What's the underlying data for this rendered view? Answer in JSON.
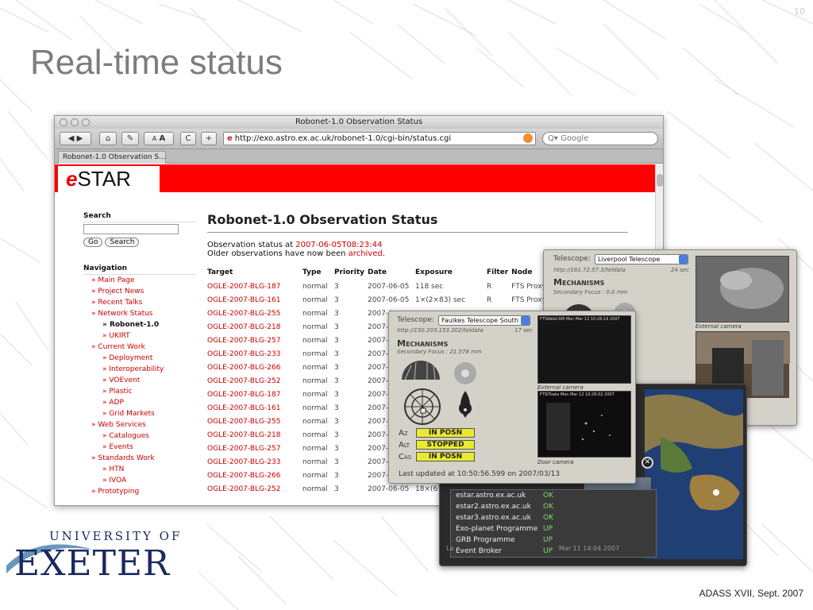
{
  "slide": {
    "number": "10",
    "title": "Real-time status",
    "footer": "ADASS XVII, Sept. 2007",
    "logo": {
      "line1": "UNIVERSITY OF",
      "line2": "EXETER"
    }
  },
  "browser": {
    "window_title": "Robonet-1.0 Observation Status",
    "url": "http://exo.astro.ex.ac.uk/robonet-1.0/cgi-bin/status.cgi",
    "search_placeholder": "Google",
    "tab_title": "Robonet-1.0 Observation S…",
    "toolbar": {
      "back": "◀",
      "forward": "▶",
      "home": "⌂",
      "edit": "✎",
      "text_small": "A",
      "text_large": "A",
      "reload": "C",
      "add": "+"
    }
  },
  "site": {
    "logo_e": "e",
    "logo_text": "STAR",
    "sidebar": {
      "search_heading": "Search",
      "go_label": "Go",
      "search_label": "Search",
      "nav_heading": "Navigation",
      "items": [
        {
          "label": "» Main Page",
          "level": 1
        },
        {
          "label": "» Project News",
          "level": 1
        },
        {
          "label": "» Recent Talks",
          "level": 1
        },
        {
          "label": "» Network Status",
          "level": 1
        },
        {
          "label": "» Robonet-1.0",
          "level": 2,
          "current": true
        },
        {
          "label": "» UKIRT",
          "level": 2
        },
        {
          "label": "» Current Work",
          "level": 1
        },
        {
          "label": "» Deployment",
          "level": 2
        },
        {
          "label": "» Interoperability",
          "level": 2
        },
        {
          "label": "» VOEvent",
          "level": 2
        },
        {
          "label": "» Plastic",
          "level": 2
        },
        {
          "label": "» ADP",
          "level": 2
        },
        {
          "label": "» Grid Markets",
          "level": 2
        },
        {
          "label": "» Web Services",
          "level": 1
        },
        {
          "label": "» Catalogues",
          "level": 2
        },
        {
          "label": "» Events",
          "level": 2
        },
        {
          "label": "» Standards Work",
          "level": 1
        },
        {
          "label": "» HTN",
          "level": 2
        },
        {
          "label": "» IVOA",
          "level": 2
        },
        {
          "label": "» Prototyping",
          "level": 1
        }
      ]
    },
    "main": {
      "heading": "Robonet-1.0 Observation Status",
      "status_prefix": "Observation status at ",
      "status_time": "2007-06-05T08:23:44",
      "older_prefix": "Older observations have now been ",
      "older_link": "archived",
      "older_suffix": ".",
      "columns": [
        "Target",
        "Type",
        "Priority",
        "Date",
        "Exposure",
        "Filter",
        "Node"
      ],
      "rows": [
        [
          "OGLE-2007-BLG-187",
          "normal",
          "3",
          "2007-06-05",
          "118 sec",
          "R",
          "FTS Proxy"
        ],
        [
          "OGLE-2007-BLG-161",
          "normal",
          "3",
          "2007-06-05",
          "1×(2×83) sec",
          "R",
          "FTS Proxy"
        ],
        [
          "OGLE-2007-BLG-255",
          "normal",
          "3",
          "2007-0",
          "",
          "",
          ""
        ],
        [
          "OGLE-2007-BLG-218",
          "normal",
          "3",
          "2007-0",
          "",
          "",
          ""
        ],
        [
          "OGLE-2007-BLG-257",
          "normal",
          "3",
          "2007-0",
          "",
          "",
          ""
        ],
        [
          "OGLE-2007-BLG-233",
          "normal",
          "3",
          "2007-0",
          "",
          "",
          ""
        ],
        [
          "OGLE-2007-BLG-266",
          "normal",
          "3",
          "2007-0",
          "",
          "",
          ""
        ],
        [
          "OGLE-2007-BLG-252",
          "normal",
          "3",
          "2007-0",
          "",
          "",
          ""
        ],
        [
          "OGLE-2007-BLG-187",
          "normal",
          "3",
          "2007-0",
          "",
          "",
          ""
        ],
        [
          "OGLE-2007-BLG-161",
          "normal",
          "3",
          "2007-0",
          "",
          "",
          ""
        ],
        [
          "OGLE-2007-BLG-255",
          "normal",
          "3",
          "2007-0",
          "",
          "",
          ""
        ],
        [
          "OGLE-2007-BLG-218",
          "normal",
          "3",
          "2007-0",
          "",
          "",
          ""
        ],
        [
          "OGLE-2007-BLG-257",
          "normal",
          "3",
          "2007-0",
          "",
          "",
          ""
        ],
        [
          "OGLE-2007-BLG-233",
          "normal",
          "3",
          "2007-0",
          "",
          "",
          ""
        ],
        [
          "OGLE-2007-BLG-266",
          "normal",
          "3",
          "2007-0",
          "",
          "",
          ""
        ],
        [
          "OGLE-2007-BLG-252",
          "normal",
          "3",
          "2007-06-05",
          "18×(6×7",
          "",
          ""
        ]
      ]
    }
  },
  "liverpool_panel": {
    "telescope_label": "Telescope:",
    "telescope_value": "Liverpool Telescope",
    "url": "http://161.72.57.3/teldata",
    "age": "24 sec",
    "mechanisms": "Mechanisms",
    "focus": "Secondary Focus : 0.0 mm",
    "external_caption": "External camera"
  },
  "faulkes_panel": {
    "telescope_label": "Telescope:",
    "telescope_value": "Faulkes Telescope South",
    "url": "http://150.203.153.202/teldata",
    "age": "17 sec",
    "mechanisms": "Mechanisms",
    "focus": "Secondary Focus : 21.578 mm",
    "cam1_overlay": "FTSWebCAM  Mon Mar 12  10:26:19  2007",
    "cam2_overlay": "FTSIToaks  Mon Mar 12  10:26:02  2007",
    "external_caption": "External camera",
    "door_caption": "Door camera",
    "axes": [
      {
        "name": "Az",
        "status": "IN POSN"
      },
      {
        "name": "Alt",
        "status": "STOPPED"
      },
      {
        "name": "Cas",
        "status": "IN POSN"
      }
    ],
    "updated": "Last updated at 10:50:56.599 on 2007/03/13"
  },
  "status_widget": {
    "items": [
      {
        "name": "estar.astro.ex.ac.uk",
        "status": "OK"
      },
      {
        "name": "estar2.astro.ex.ac.uk",
        "status": "OK"
      },
      {
        "name": "estar3.astro.ex.ac.uk",
        "status": "OK"
      },
      {
        "name": "Exo-planet Programme",
        "status": "UP"
      },
      {
        "name": "GRB Programme",
        "status": "UP"
      },
      {
        "name": "Event Broker",
        "status": "UP"
      }
    ],
    "close": "✕",
    "overlay_prefix": "La",
    "overlay_text": "Mar 11  14:04  2007"
  },
  "colors": {
    "estar_red": "#ff0000",
    "link_red": "#cc0000",
    "status_green": "#7fdc6a",
    "axis_yellow": "#e8ea30",
    "title_grey": "#7d7d7d"
  }
}
